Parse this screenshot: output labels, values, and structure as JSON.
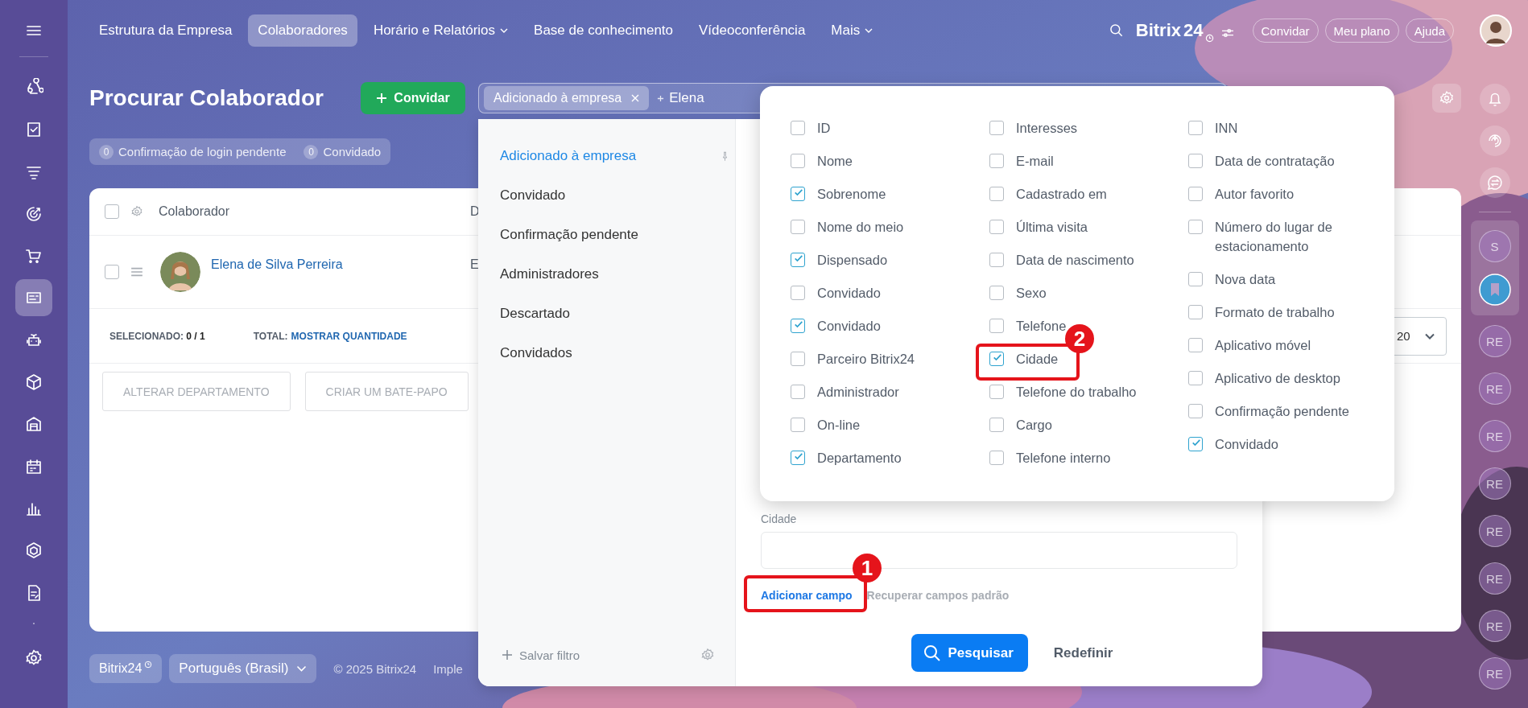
{
  "left_sidebar": {
    "items": [
      {
        "selected": false
      },
      {
        "selected": false
      },
      {
        "selected": false
      },
      {
        "selected": false
      },
      {
        "selected": false
      },
      {
        "selected": true
      },
      {
        "selected": false
      },
      {
        "selected": false
      },
      {
        "selected": false
      },
      {
        "selected": false
      },
      {
        "selected": false
      },
      {
        "selected": false
      },
      {
        "selected": false
      }
    ]
  },
  "top_nav": {
    "items": [
      {
        "label": "Estrutura da Empresa",
        "selected": false,
        "has_menu": false
      },
      {
        "label": "Colaboradores",
        "selected": true,
        "has_menu": false
      },
      {
        "label": "Horário e Relatórios",
        "selected": false,
        "has_menu": true
      },
      {
        "label": "Base de conhecimento",
        "selected": false,
        "has_menu": false
      },
      {
        "label": "Vídeoconferência",
        "selected": false,
        "has_menu": false
      },
      {
        "label": "Mais",
        "selected": false,
        "has_menu": true
      }
    ]
  },
  "header_right": {
    "logo": "Bitrix",
    "logo_number": "24",
    "buttons": [
      "Convidar",
      "Meu plano",
      "Ajuda"
    ]
  },
  "page": {
    "title": "Procurar Colaborador",
    "add_button": "Convidar",
    "filter": {
      "tag": "Adicionado à empresa",
      "query": "Elena"
    },
    "counters": [
      {
        "count": "0",
        "label": "Confirmação de login pendente"
      },
      {
        "count": "0",
        "label": "Convidado"
      }
    ]
  },
  "grid": {
    "select_all": false,
    "columns": [
      {
        "label": "Colaborador"
      },
      {
        "label": "D"
      }
    ],
    "rows": [
      {
        "selected": false,
        "name": "Elena de Silva Perreira",
        "column_2": "E"
      }
    ],
    "footer": {
      "selected_label": "SELECIONADO:",
      "selected_value": "0 / 1",
      "total_label": "TOTAL:",
      "total_link": "MOSTRAR QUANTIDADE",
      "page_size": "20"
    },
    "actions": [
      "ALTERAR DEPARTAMENTO",
      "CRIAR UM BATE-PAPO"
    ]
  },
  "footer": {
    "brand": "Bitrix24",
    "language": "Português (Brasil)",
    "copyright": "© 2025 Bitrix24",
    "link": "Imple"
  },
  "filter_popup": {
    "presets": [
      {
        "label": "Adicionado à empresa",
        "selected": true
      },
      {
        "label": "Convidado",
        "selected": false
      },
      {
        "label": "Confirmação pendente",
        "selected": false
      },
      {
        "label": "Administradores",
        "selected": false
      },
      {
        "label": "Descartado",
        "selected": false
      },
      {
        "label": "Convidados",
        "selected": false
      }
    ],
    "save_label": "Salvar filtro",
    "fields": [
      {
        "label": "Cidade"
      }
    ],
    "add_field": "Adicionar campo",
    "restore_fields": "Recuperar campos padrão",
    "search_button": "Pesquisar",
    "reset_button": "Redefinir"
  },
  "field_chooser": {
    "columns": [
      {
        "items": [
          {
            "label": "ID",
            "checked": false
          },
          {
            "label": "Nome",
            "checked": false
          },
          {
            "label": "Sobrenome",
            "checked": true
          },
          {
            "label": "Nome do meio",
            "checked": false
          },
          {
            "label": "Dispensado",
            "checked": true
          },
          {
            "label": "Convidado",
            "checked": false
          },
          {
            "label": "Convidado",
            "checked": true
          },
          {
            "label": "Parceiro Bitrix24",
            "checked": false
          },
          {
            "label": "Administrador",
            "checked": false
          },
          {
            "label": "On-line",
            "checked": false
          },
          {
            "label": "Departamento",
            "checked": true
          }
        ]
      },
      {
        "items": [
          {
            "label": "Interesses",
            "checked": false
          },
          {
            "label": "E-mail",
            "checked": false
          },
          {
            "label": "Cadastrado em",
            "checked": false
          },
          {
            "label": "Última visita",
            "checked": false
          },
          {
            "label": "Data de nascimento",
            "checked": false
          },
          {
            "label": "Sexo",
            "checked": false
          },
          {
            "label": "Telefone",
            "checked": false
          },
          {
            "label": "Cidade",
            "checked": true
          },
          {
            "label": "Telefone do trabalho",
            "checked": false
          },
          {
            "label": "Cargo",
            "checked": false
          },
          {
            "label": "Telefone interno",
            "checked": false
          }
        ]
      },
      {
        "items": [
          {
            "label": "INN",
            "checked": false
          },
          {
            "label": "Data de contratação",
            "checked": false
          },
          {
            "label": "Autor favorito",
            "checked": false
          },
          {
            "label": "Número do lugar de estacionamento",
            "checked": false
          },
          {
            "label": "Nova data",
            "checked": false
          },
          {
            "label": "Formato de trabalho",
            "checked": false
          },
          {
            "label": "Aplicativo móvel",
            "checked": false
          },
          {
            "label": "Aplicativo de desktop",
            "checked": false
          },
          {
            "label": "Confirmação pendente",
            "checked": false
          },
          {
            "label": "Convidado",
            "checked": true
          }
        ]
      }
    ]
  },
  "right_sidebar": {
    "pinned": [
      {
        "initials": "S"
      }
    ],
    "recent": [
      {
        "initials": "RE"
      },
      {
        "initials": "RE"
      },
      {
        "initials": "RE"
      },
      {
        "initials": "RE"
      },
      {
        "initials": "RE"
      },
      {
        "initials": "RE"
      },
      {
        "initials": "RE"
      },
      {
        "initials": "RE"
      }
    ]
  },
  "annotations": [
    {
      "number": "1"
    },
    {
      "number": "2"
    }
  ]
}
